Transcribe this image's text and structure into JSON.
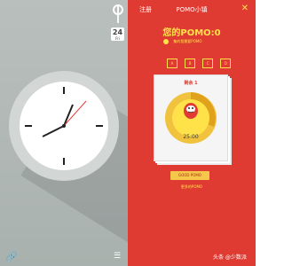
{
  "left": {
    "calendar_day": "24",
    "calendar_dow": "Fri"
  },
  "right": {
    "register_label": "注册",
    "title": "POMO小镇",
    "headline": "您的POMO:0",
    "subline": "集的我需要POMO",
    "tabs": [
      "A",
      "B",
      "C",
      "D"
    ],
    "card_label": "剩余 1",
    "timer": "25:00",
    "good_button": "GOOD POMO",
    "link": "更多的POMO",
    "watermark": "头条 @少数派"
  },
  "colors": {
    "accent_red": "#e03b32",
    "accent_yellow": "#ffe24a",
    "clock_gray": "#d2d6d5"
  },
  "icons": [
    "close-icon",
    "calendar-icon",
    "link-icon",
    "list-icon",
    "apple-icon",
    "daruma-icon"
  ]
}
